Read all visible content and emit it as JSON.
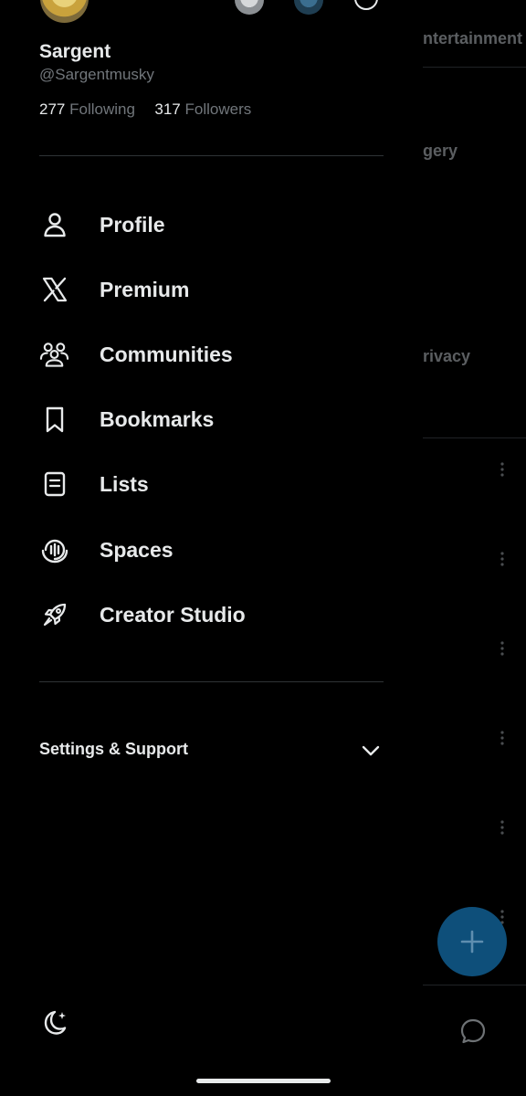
{
  "background": {
    "visible_fragments": [
      "ntertainment",
      "gery",
      "rivacy"
    ],
    "fab_icon": "plus-icon",
    "nav_icon": "chat-bubble-icon"
  },
  "profile": {
    "display_name": "Sargent",
    "handle": "@Sargentmusky",
    "following_count": "277",
    "following_label": "Following",
    "followers_count": "317",
    "followers_label": "Followers"
  },
  "menu": {
    "items": [
      {
        "label": "Profile",
        "icon": "person-icon"
      },
      {
        "label": "Premium",
        "icon": "x-logo-icon"
      },
      {
        "label": "Communities",
        "icon": "communities-icon"
      },
      {
        "label": "Bookmarks",
        "icon": "bookmark-icon"
      },
      {
        "label": "Lists",
        "icon": "list-icon"
      },
      {
        "label": "Spaces",
        "icon": "spaces-icon"
      },
      {
        "label": "Creator Studio",
        "icon": "rocket-icon"
      }
    ]
  },
  "settings": {
    "label": "Settings & Support",
    "expanded": false
  },
  "colors": {
    "background": "#000000",
    "primary_text": "#e7e9ea",
    "secondary_text": "#71767b",
    "divider": "#2f3336",
    "fab": "#0e4f7a"
  }
}
